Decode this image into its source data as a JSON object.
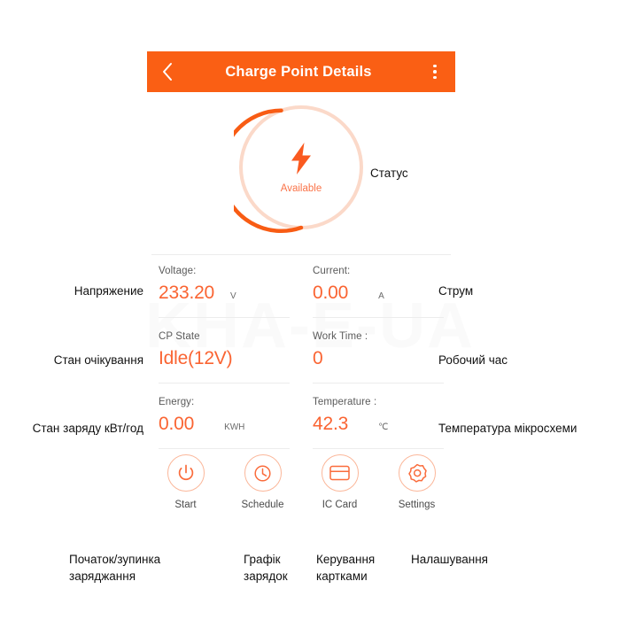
{
  "watermark": {
    "text": "KHA-E-UA"
  },
  "appbar": {
    "back_icon": "chevron-left-icon",
    "title": "Charge Point Details",
    "menu_icon": "overflow-menu-icon",
    "bg_color": "#fa5f14"
  },
  "status_dial": {
    "icon": "lightning-bolt-icon",
    "label": "Available",
    "track_color": "#fbd9c9",
    "arc_color": "#f85c14",
    "accent": "#fa7348"
  },
  "fields": [
    [
      {
        "label": "Voltage:",
        "value": "233.20",
        "unit": "V"
      },
      {
        "label": "Current:",
        "value": "0.00",
        "unit": "A"
      }
    ],
    [
      {
        "label": "CP State",
        "value": "Idle(12V)",
        "unit": ""
      },
      {
        "label": "Work Time :",
        "value": "0",
        "unit": ""
      }
    ],
    [
      {
        "label": "Energy:",
        "value": "0.00",
        "unit": "KWH"
      },
      {
        "label": "Temperature :",
        "value": "42.3",
        "unit": "℃"
      }
    ]
  ],
  "actions": [
    {
      "icon": "power-icon",
      "label": "Start"
    },
    {
      "icon": "clock-icon",
      "label": "Schedule"
    },
    {
      "icon": "ic-card-icon",
      "label": "IC Card"
    },
    {
      "icon": "gear-icon",
      "label": "Settings"
    }
  ],
  "annotations": {
    "status": "Статус",
    "voltage": "Напряжение",
    "current": "Струм",
    "cp_state": "Стан очікування",
    "work_time": "Робочий час",
    "energy": "Стан заряду кВт/год",
    "temperature": "Температура мікросхеми",
    "start": "Початок/зупинка\nзаряджання",
    "schedule": "Графік\nзарядок",
    "ic_card": "Керування\nкартками",
    "settings": "Налашування"
  }
}
